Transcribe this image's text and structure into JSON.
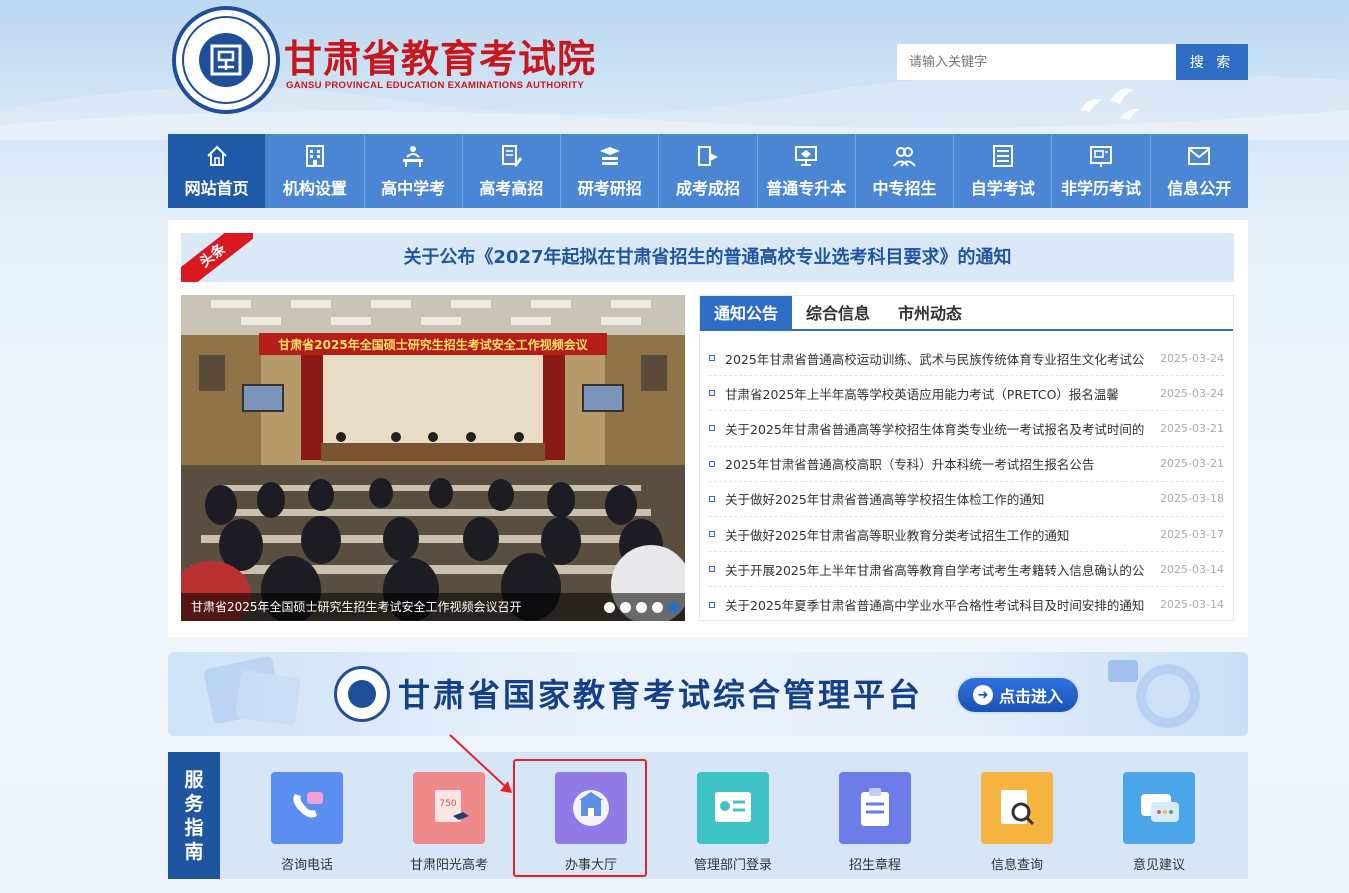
{
  "header": {
    "site_title": "甘肃省教育考试院",
    "site_subtitle": "GANSU PROVINCAL EDUCATION EXAMINATIONS AUTHORITY",
    "search_placeholder": "请输入关键字",
    "search_button": "搜 索"
  },
  "nav": {
    "items": [
      {
        "label": "网站首页",
        "icon": "home-icon",
        "active": true
      },
      {
        "label": "机构设置",
        "icon": "building-icon"
      },
      {
        "label": "高中学考",
        "icon": "student-desk-icon"
      },
      {
        "label": "高考高招",
        "icon": "document-pen-icon"
      },
      {
        "label": "研考研招",
        "icon": "graduation-books-icon"
      },
      {
        "label": "成考成招",
        "icon": "presentation-icon"
      },
      {
        "label": "普通专升本",
        "icon": "lecture-screen-icon"
      },
      {
        "label": "中专招生",
        "icon": "users-icon"
      },
      {
        "label": "自学考试",
        "icon": "book-list-icon"
      },
      {
        "label": "非学历考试",
        "icon": "certificate-icon"
      },
      {
        "label": "信息公开",
        "icon": "mail-icon"
      }
    ]
  },
  "headline": {
    "tag": "头条",
    "text": "关于公布《2027年起拟在甘肃省招生的普通高校专业选考科目要求》的通知"
  },
  "carousel": {
    "banner_text": "甘肃省2025年全国硕士研究生招生考试安全工作视频会议",
    "caption": "甘肃省2025年全国硕士研究生招生考试安全工作视频会议召开",
    "dots": 5,
    "active_dot": 5
  },
  "news": {
    "tabs": [
      "通知公告",
      "综合信息",
      "市州动态"
    ],
    "active_tab": 0,
    "items": [
      {
        "title": "2025年甘肃省普通高校运动训练、武术与民族传统体育专业招生文化考试公",
        "date": "2025-03-24"
      },
      {
        "title": "甘肃省2025年上半年高等学校英语应用能力考试（PRETCO）报名温馨",
        "date": "2025-03-24"
      },
      {
        "title": "关于2025年甘肃省普通高等学校招生体育类专业统一考试报名及考试时间的",
        "date": "2025-03-21"
      },
      {
        "title": "2025年甘肃省普通高校高职（专科）升本科统一考试招生报名公告",
        "date": "2025-03-21"
      },
      {
        "title": "关于做好2025年甘肃省普通高等学校招生体检工作的通知",
        "date": "2025-03-18"
      },
      {
        "title": "关于做好2025年甘肃省高等职业教育分类考试招生工作的通知",
        "date": "2025-03-17"
      },
      {
        "title": "关于开展2025年上半年甘肃省高等教育自学考试考生考籍转入信息确认的公",
        "date": "2025-03-14"
      },
      {
        "title": "关于2025年夏季甘肃省普通高中学业水平合格性考试科目及时间安排的通知",
        "date": "2025-03-14"
      }
    ]
  },
  "banner": {
    "title": "甘肃省国家教育考试综合管理平台",
    "button": "点击进入"
  },
  "services": {
    "label": [
      "服",
      "务",
      "指",
      "南"
    ],
    "items": [
      {
        "label": "咨询电话",
        "icon": "phone-chat-icon",
        "color": "#5a8ef0"
      },
      {
        "label": "甘肃阳光高考",
        "icon": "book-750-icon",
        "color": "#f08a8a"
      },
      {
        "label": "办事大厅",
        "icon": "service-hall-icon",
        "color": "#8f7ae6"
      },
      {
        "label": "管理部门登录",
        "icon": "id-card-icon",
        "color": "#3fc2c6"
      },
      {
        "label": "招生章程",
        "icon": "clipboard-icon",
        "color": "#6c7ce8"
      },
      {
        "label": "信息查询",
        "icon": "search-document-icon",
        "color": "#f5b440"
      },
      {
        "label": "意见建议",
        "icon": "feedback-chat-icon",
        "color": "#4aa6e8"
      }
    ]
  }
}
